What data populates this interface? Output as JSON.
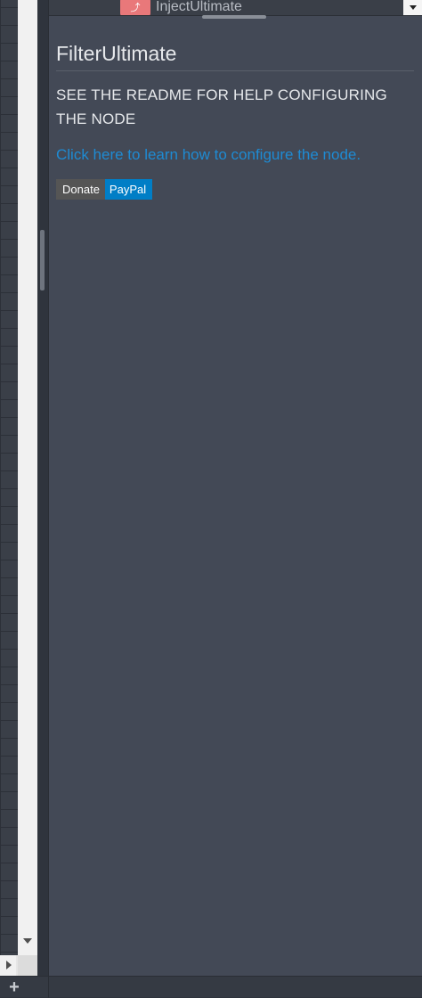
{
  "palette": {
    "node_label": "InjectUltimate",
    "node_icon": "arrow-icon"
  },
  "help": {
    "title": "FilterUltimate",
    "heading": "SEE THE README FOR HELP CONFIGURING THE NODE",
    "link_text": "Click here to learn how to configure the node.",
    "donate_left": "Donate",
    "donate_right": "PayPal"
  },
  "bottom_bar": {
    "add_label": "+"
  },
  "colors": {
    "sidebar_bg": "#434956",
    "link": "#1e8bd3",
    "paypal_blue": "#007ec6",
    "node_red": "#e9787a"
  }
}
